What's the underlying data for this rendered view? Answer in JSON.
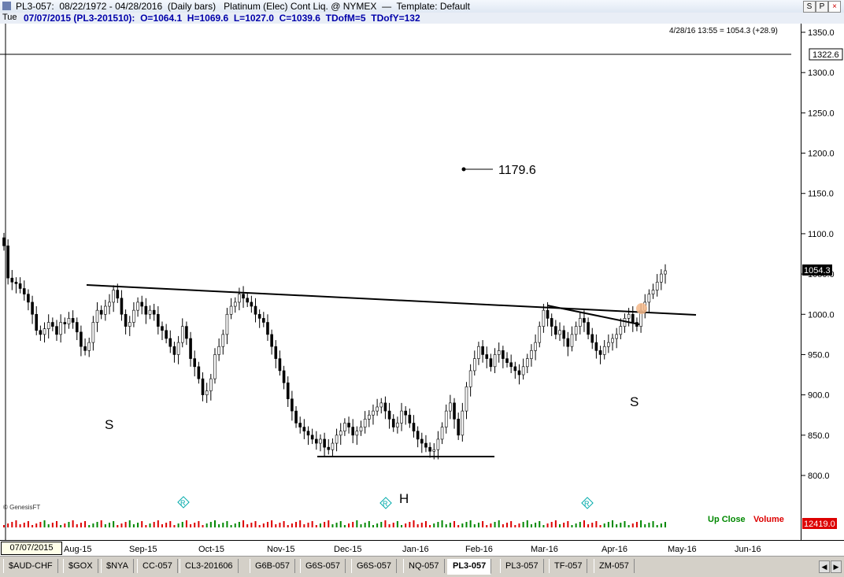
{
  "window": {
    "title": "PL3-057:  08/22/1972 - 04/28/2016  (Daily bars)   Platinum (Elec) Cont Liq. @ NYMEX  —  Template: Default",
    "buttons": [
      "S",
      "P",
      "×"
    ]
  },
  "bar_info": {
    "day": "Tue",
    "text": "07/07/2015 (PL3-201510):  O=1064.1  H=1069.6  L=1027.0  C=1039.6  TDofM=5  TDofY=132"
  },
  "last_update": "4/28/16 13:55 = 1054.3 (+28.9)",
  "price_axis": {
    "ticks": [
      "1350.0",
      "1300.0",
      "1250.0",
      "1200.0",
      "1150.0",
      "1100.0",
      "1050.0",
      "1000.0",
      "950.0",
      "900.0",
      "850.0",
      "800.0"
    ],
    "last_price_label": "1054.3",
    "hline_label": "1322.6",
    "volume_label": "12419.0"
  },
  "annotations": {
    "target_label": "1179.6",
    "left_shoulder": "S",
    "head": "H",
    "right_shoulder": "S",
    "watermark": "© GenesisFT",
    "rollover_marker": "R",
    "legend_up": "Up Close",
    "legend_volume": "Volume"
  },
  "date_axis": {
    "cursor_date": "07/07/2015",
    "labels": [
      "Aug-15",
      "Sep-15",
      "Oct-15",
      "Nov-15",
      "Dec-15",
      "Jan-16",
      "Feb-16",
      "Mar-16",
      "Apr-16",
      "May-16",
      "Jun-16"
    ]
  },
  "tabs": [
    "$AUD-CHF",
    "$GOX",
    "$NYA",
    "CC-057",
    "CL3-201606",
    "G6B-057",
    "G6S-057",
    "G6S-057",
    "NQ-057",
    "PL3-057",
    "PL3-057",
    "TF-057",
    "ZM-057"
  ],
  "active_tab_index": 9,
  "colors": {
    "up_close": "#008800",
    "volume": "#dd0000",
    "price_text": "#0000aa",
    "marker": "#00aaaa"
  },
  "chart_data": {
    "type": "ohlc",
    "y_unit": "price",
    "ylim": [
      780,
      1360
    ],
    "x_labels": [
      "Aug-15",
      "Sep-15",
      "Oct-15",
      "Nov-15",
      "Dec-15",
      "Jan-16",
      "Feb-16",
      "Mar-16",
      "Apr-16",
      "May-16",
      "Jun-16"
    ],
    "close_series": [
      1085,
      1045,
      1040,
      1038,
      1032,
      1025,
      1015,
      1000,
      980,
      975,
      982,
      990,
      985,
      975,
      990,
      988,
      995,
      990,
      978,
      960,
      955,
      965,
      990,
      1005,
      1000,
      1010,
      1015,
      1030,
      1020,
      1000,
      985,
      990,
      1005,
      1015,
      1010,
      1000,
      1005,
      1000,
      985,
      980,
      970,
      960,
      950,
      965,
      985,
      970,
      945,
      935,
      920,
      900,
      905,
      920,
      950,
      960,
      975,
      1000,
      1010,
      1015,
      1025,
      1020,
      1015,
      1010,
      1000,
      995,
      990,
      975,
      960,
      945,
      930,
      915,
      895,
      880,
      865,
      860,
      855,
      850,
      845,
      840,
      845,
      835,
      832,
      840,
      850,
      855,
      865,
      860,
      850,
      855,
      860,
      870,
      875,
      880,
      885,
      890,
      880,
      870,
      860,
      865,
      880,
      875,
      865,
      855,
      845,
      840,
      835,
      830,
      832,
      845,
      860,
      880,
      890,
      870,
      850,
      880,
      910,
      930,
      945,
      960,
      950,
      945,
      935,
      950,
      955,
      945,
      940,
      935,
      930,
      925,
      935,
      945,
      955,
      965,
      985,
      1005,
      995,
      985,
      975,
      980,
      970,
      960,
      975,
      985,
      995,
      990,
      975,
      965,
      955,
      950,
      960,
      965,
      970,
      975,
      985,
      995,
      1000,
      990,
      985,
      1005,
      1015,
      1025,
      1030,
      1040,
      1050,
      1054
    ]
  }
}
